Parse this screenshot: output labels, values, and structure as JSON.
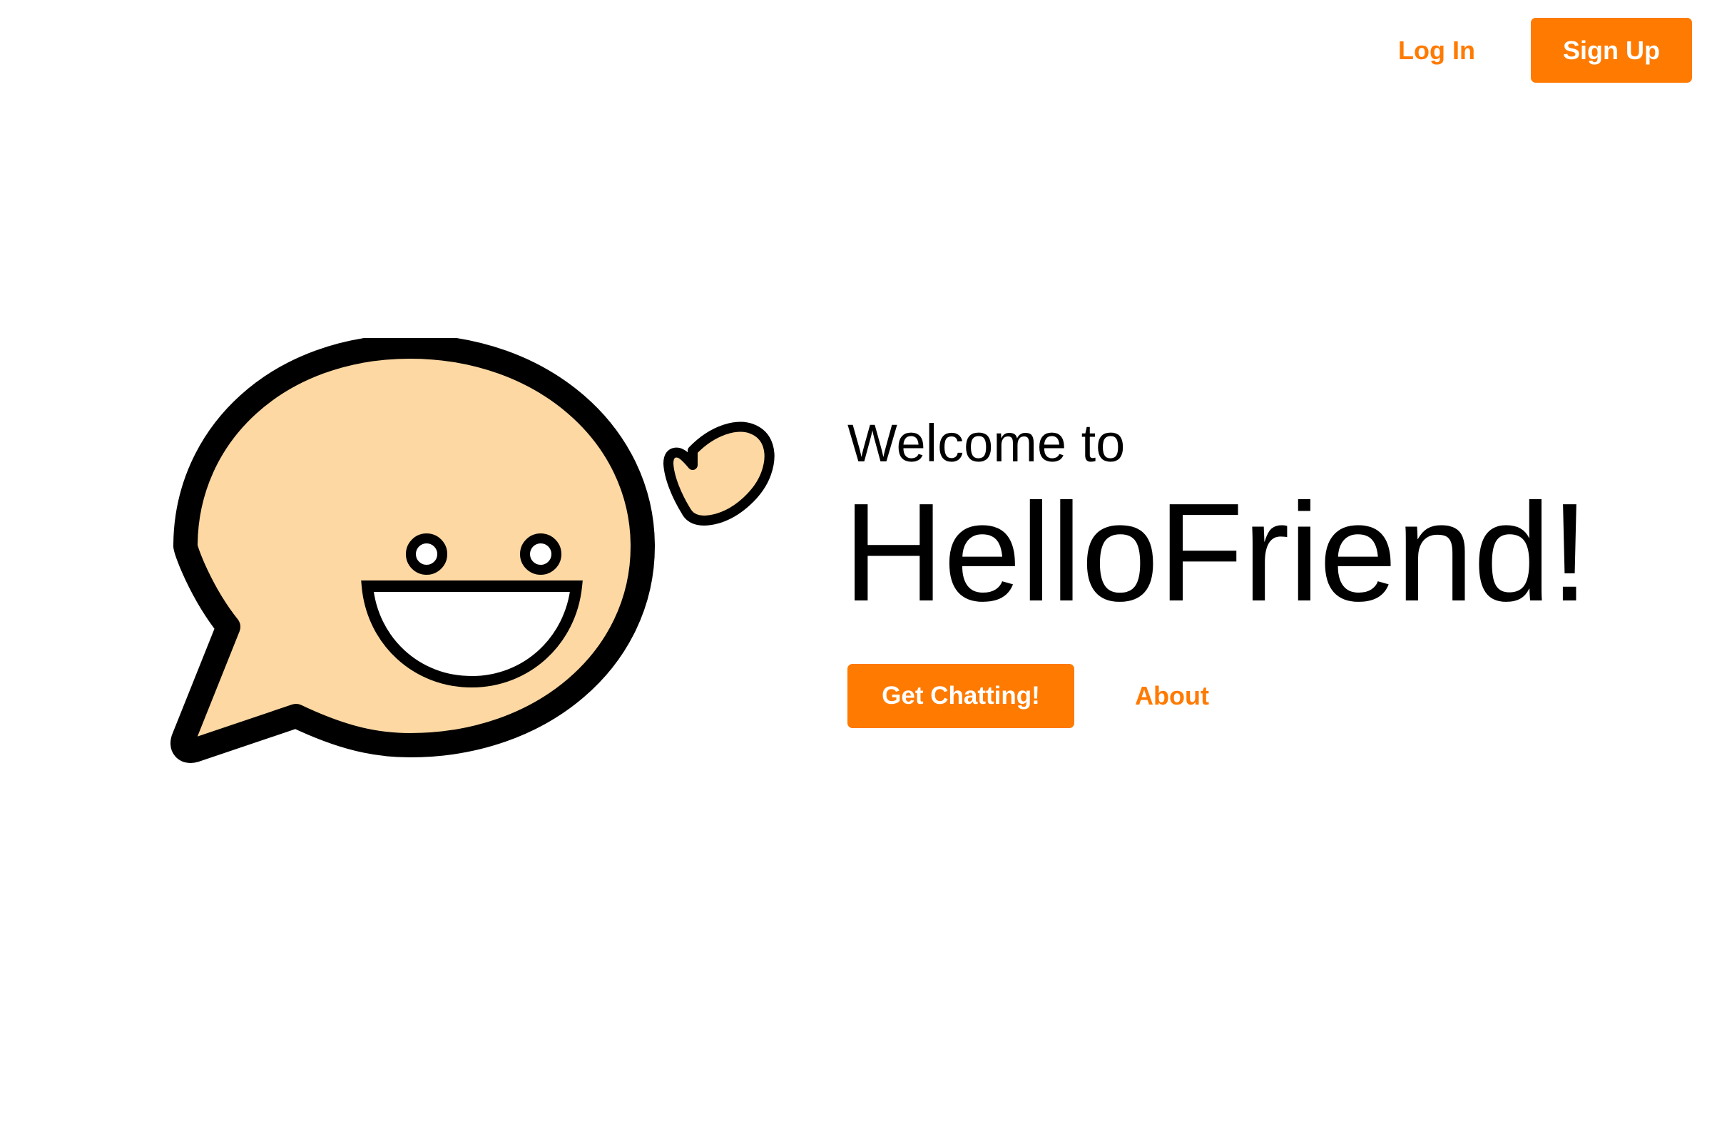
{
  "nav": {
    "login_label": "Log In",
    "signup_label": "Sign Up"
  },
  "hero": {
    "welcome": "Welcome to",
    "brand": "HelloFriend!",
    "primary_cta": "Get Chatting!",
    "secondary_link": "About"
  },
  "mascot": {
    "icon": "smiling-speech-bubble-icon",
    "heart_icon": "heart-icon"
  },
  "colors": {
    "accent": "#ff7a00",
    "bubble_fill": "#fdd8a3",
    "outline": "#000000",
    "background": "#ffffff"
  }
}
